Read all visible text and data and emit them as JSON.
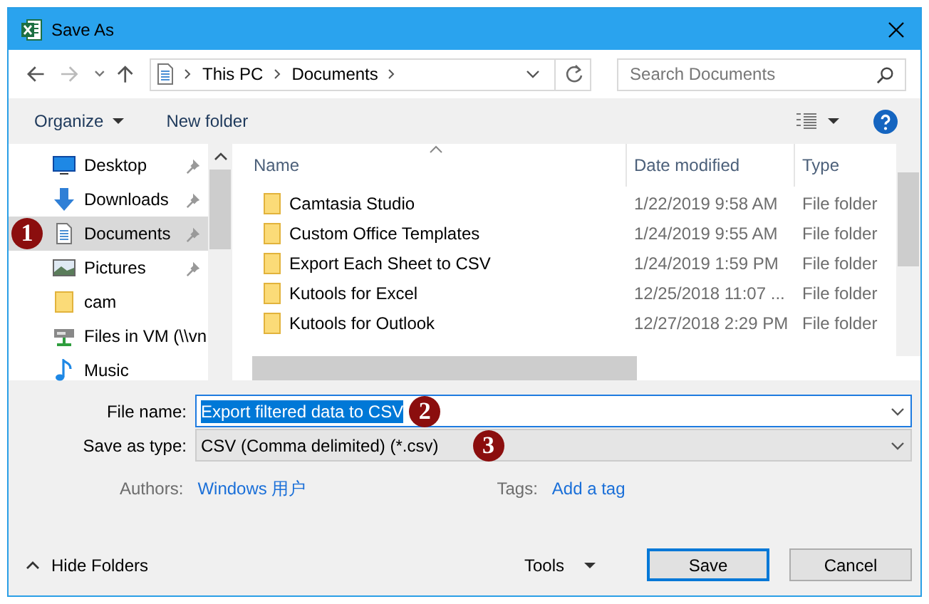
{
  "window": {
    "title": "Save As"
  },
  "address": {
    "crumbs": [
      "This PC",
      "Documents"
    ]
  },
  "search": {
    "placeholder": "Search Documents"
  },
  "toolbar": {
    "organize": "Organize",
    "new_folder": "New folder"
  },
  "sidebar": {
    "items": [
      {
        "label": "Desktop",
        "kind": "desktop",
        "pinned": true,
        "selected": false
      },
      {
        "label": "Downloads",
        "kind": "downloads",
        "pinned": true,
        "selected": false
      },
      {
        "label": "Documents",
        "kind": "documents",
        "pinned": true,
        "selected": true
      },
      {
        "label": "Pictures",
        "kind": "pictures",
        "pinned": true,
        "selected": false
      },
      {
        "label": "cam",
        "kind": "folder",
        "pinned": false,
        "selected": false
      },
      {
        "label": "Files in VM (\\\\vn",
        "kind": "drive",
        "pinned": false,
        "selected": false
      },
      {
        "label": "Music",
        "kind": "music",
        "pinned": false,
        "selected": false
      }
    ]
  },
  "table": {
    "columns": [
      "Name",
      "Date modified",
      "Type"
    ],
    "rows": [
      {
        "name": "Camtasia Studio",
        "date": "1/22/2019 9:58 AM",
        "type": "File folder"
      },
      {
        "name": "Custom Office Templates",
        "date": "1/24/2019 9:55 AM",
        "type": "File folder"
      },
      {
        "name": "Export Each Sheet to CSV",
        "date": "1/24/2019 1:59 PM",
        "type": "File folder"
      },
      {
        "name": "Kutools for Excel",
        "date": "12/25/2018 11:07 ...",
        "type": "File folder"
      },
      {
        "name": "Kutools for Outlook",
        "date": "12/27/2018 2:29 PM",
        "type": "File folder"
      }
    ]
  },
  "form": {
    "file_name_label": "File name:",
    "file_name": "Export filtered data to CSV",
    "type_label": "Save as type:",
    "type_value": "CSV (Comma delimited) (*.csv)",
    "authors_label": "Authors:",
    "authors": "Windows 用户",
    "tags_label": "Tags:",
    "tags": "Add a tag"
  },
  "footer": {
    "hide_folders": "Hide Folders",
    "tools": "Tools",
    "buttons": [
      "Save",
      "Cancel"
    ]
  },
  "callouts": [
    "1",
    "2",
    "3"
  ]
}
